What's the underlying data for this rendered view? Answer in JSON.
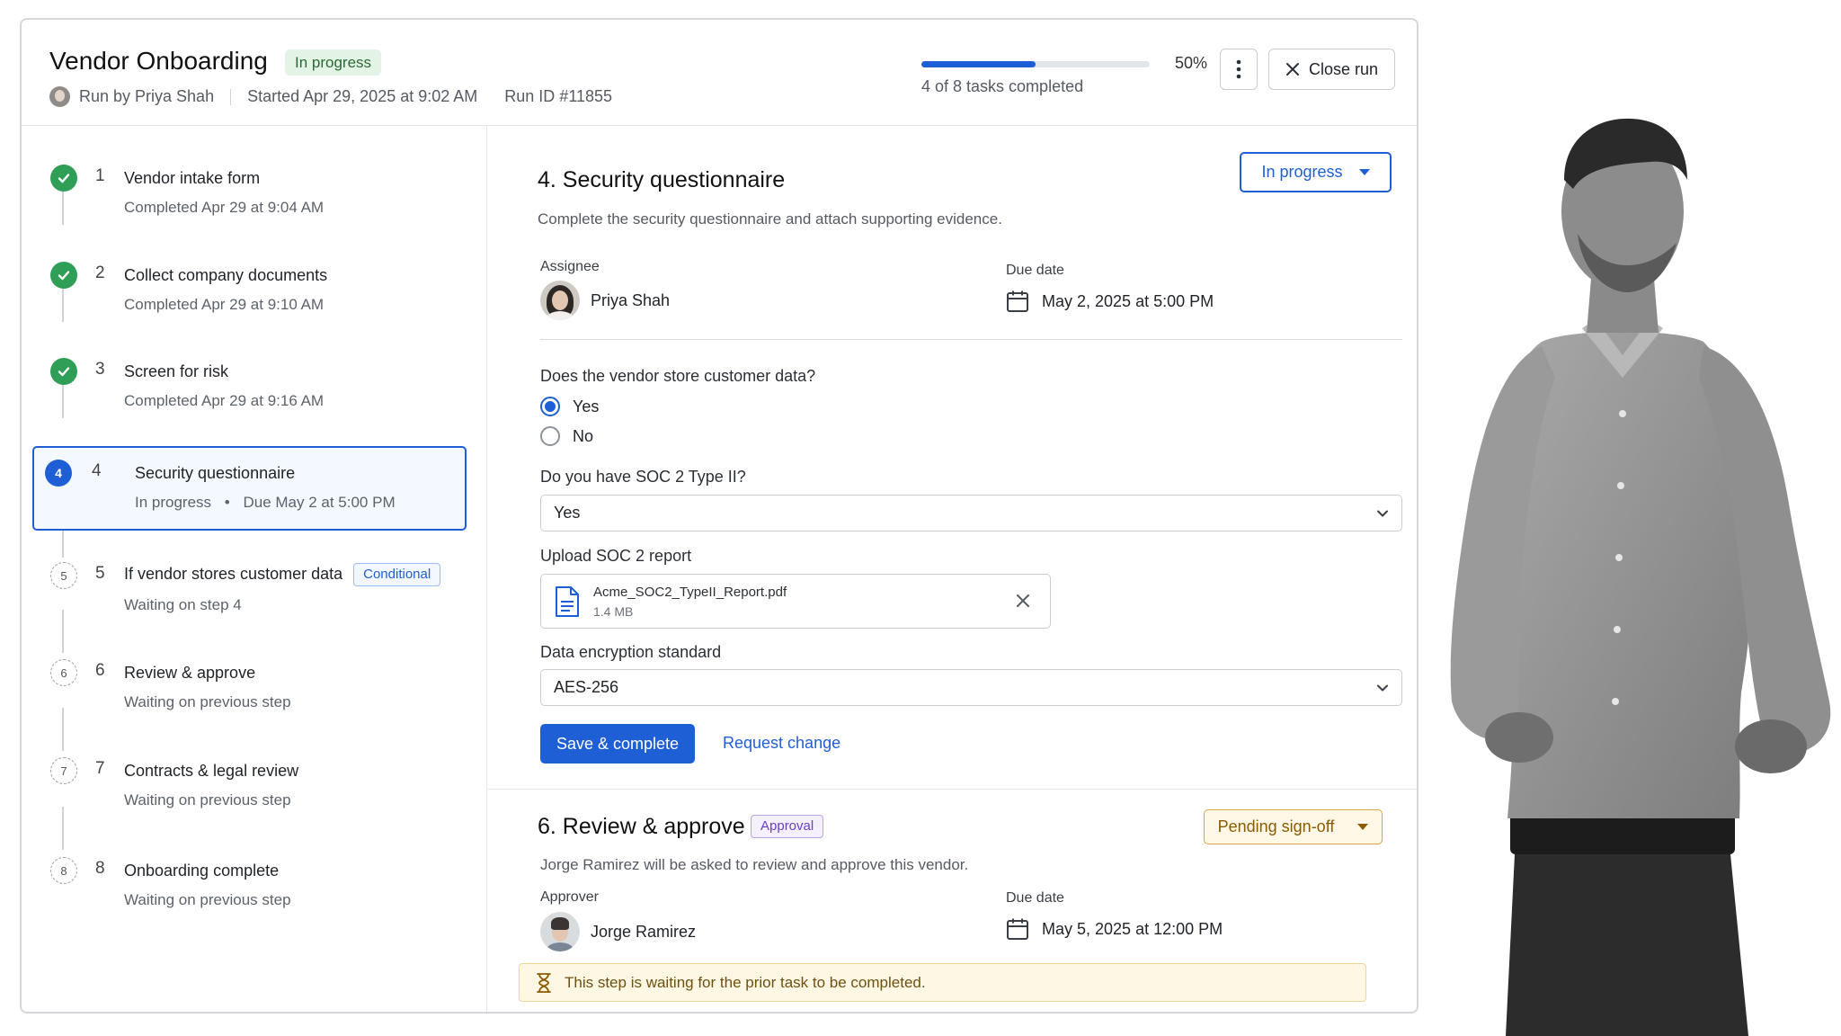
{
  "header": {
    "title": "Vendor Onboarding",
    "status_badge": "In progress",
    "run_by": "Run by Priya Shah",
    "started": "Started Apr 29, 2025 at 9:02 AM",
    "run_id": "Run ID #11855",
    "progress_fraction": 0.5,
    "progress_percent": "50%",
    "progress_label": "4 of 8 tasks completed",
    "close_label": "Close run"
  },
  "steps": [
    {
      "num": "1",
      "name": "Vendor intake form",
      "sub": "Completed Apr 29 at 9:04 AM",
      "state": "done"
    },
    {
      "num": "2",
      "name": "Collect company documents",
      "sub": "Completed Apr 29 at 9:10 AM",
      "state": "done"
    },
    {
      "num": "3",
      "name": "Screen for risk",
      "sub": "Completed Apr 29 at 9:16 AM",
      "state": "done"
    },
    {
      "num": "4",
      "name": "Security questionnaire",
      "sub_status": "In progress",
      "sub_due": "Due May 2 at 5:00 PM",
      "state": "current"
    },
    {
      "num": "5",
      "name": "If vendor stores customer data",
      "tag": "Conditional",
      "sub": "Waiting on step 4",
      "state": "pending"
    },
    {
      "num": "6",
      "name": "Review & approve",
      "sub": "Waiting on previous step",
      "state": "pending"
    },
    {
      "num": "7",
      "name": "Contracts & legal review",
      "sub": "Waiting on previous step",
      "state": "pending"
    },
    {
      "num": "8",
      "name": "Onboarding complete",
      "sub": "Waiting on previous step",
      "state": "pending"
    }
  ],
  "task": {
    "title": "4. Security questionnaire",
    "status": "In progress",
    "description": "Complete the security questionnaire and attach supporting evidence.",
    "assignee_label": "Assignee",
    "assignee": "Priya Shah",
    "due_label": "Due date",
    "due": "May 2, 2025 at 5:00 PM",
    "q1": "Does the vendor store customer data?",
    "q1_options": [
      "Yes",
      "No"
    ],
    "q1_selected": "Yes",
    "q2": "Do you have SOC 2 Type II?",
    "q2_value": "Yes",
    "upload_label": "Upload SOC 2 report",
    "file_name": "Acme_SOC2_TypeII_Report.pdf",
    "file_size": "1.4 MB",
    "enc_label": "Data encryption standard",
    "enc_value": "AES-256",
    "save_label": "Save & complete",
    "request_label": "Request change"
  },
  "review": {
    "title": "6. Review & approve",
    "badge": "Approval",
    "status": "Pending sign-off",
    "description": "Jorge Ramirez will be asked to review and approve this vendor.",
    "approver_label": "Approver",
    "approver": "Jorge Ramirez",
    "due_label": "Due date",
    "due": "May 5, 2025 at 12:00 PM",
    "warning": "This step is waiting for the prior task to be completed."
  },
  "colors": {
    "accent": "#1f5fd6",
    "success": "#2f9e57",
    "warning_bg": "#fdf7e3",
    "approval_purple": "#6a3fc2"
  }
}
